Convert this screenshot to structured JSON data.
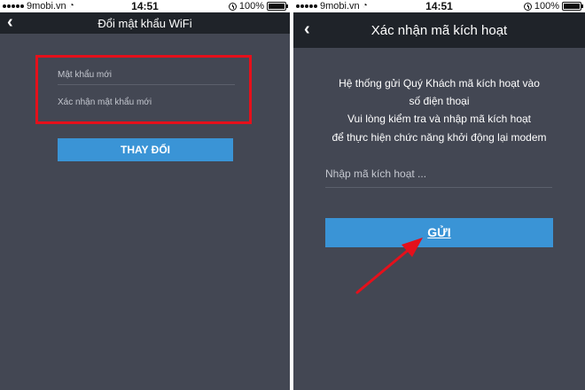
{
  "left_screen": {
    "status_bar": {
      "carrier": "9mobi.vn",
      "time": "14:51",
      "battery": "100%"
    },
    "header": {
      "title": "Đổi mật khẩu WiFi"
    },
    "form": {
      "new_password_placeholder": "Mật khẩu mới",
      "confirm_password_placeholder": "Xác nhận mật khẩu mới",
      "submit_label": "THAY ĐỔI"
    }
  },
  "right_screen": {
    "status_bar": {
      "carrier": "9mobi.vn",
      "time": "14:51",
      "battery": "100%"
    },
    "header": {
      "title": "Xác nhận mã kích hoạt"
    },
    "info_lines": [
      "Hệ thống gửi Quý Khách mã kích hoạt vào",
      "số điện thoại",
      "Vui lòng kiểm tra và nhập mã kích hoạt",
      "để thực hiện chức năng khởi động lại modem"
    ],
    "code_placeholder": "Nhập mã kích hoạt ...",
    "submit_label": "GỬI"
  },
  "icons": {
    "back": "chevron-left-icon",
    "wifi": "wifi-icon",
    "signal": "signal-dots-icon",
    "clock": "clock-icon",
    "battery": "battery-icon",
    "annotation": "red-arrow-icon"
  },
  "colors": {
    "screen_bg": "#434753",
    "nav_bg": "#1f2329",
    "button_blue": "#3a94d6",
    "highlight_red": "#e5101b"
  }
}
